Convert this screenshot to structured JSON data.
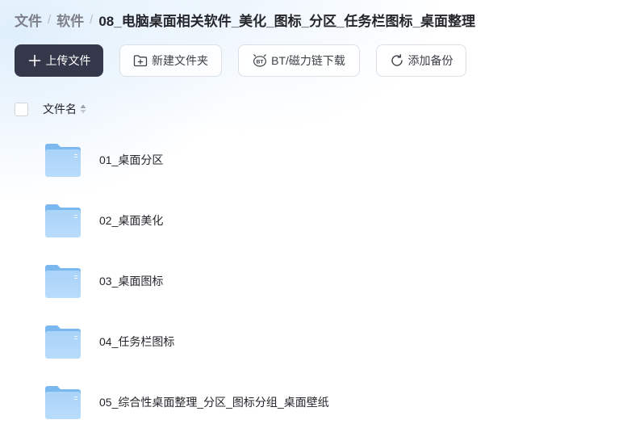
{
  "breadcrumb": {
    "items": [
      "文件",
      "软件"
    ],
    "separator": "/",
    "current": "08_电脑桌面相关软件_美化_图标_分区_任务栏图标_桌面整理"
  },
  "toolbar": {
    "upload_label": "上传文件",
    "new_folder_label": "新建文件夹",
    "bt_label": "BT/磁力链下载",
    "backup_label": "添加备份"
  },
  "list": {
    "header_label": "文件名",
    "files": [
      {
        "name": "01_桌面分区",
        "icon": "folder-icon"
      },
      {
        "name": "02_桌面美化",
        "icon": "folder-icon"
      },
      {
        "name": "03_桌面图标",
        "icon": "folder-icon"
      },
      {
        "name": "04_任务栏图标",
        "icon": "folder-icon"
      },
      {
        "name": "05_综合性桌面整理_分区_图标分组_桌面壁纸",
        "icon": "folder-icon"
      }
    ]
  },
  "colors": {
    "primary_button": "#34384a",
    "folder_light": "#a9d3f8",
    "folder_dark": "#7ab8ef"
  }
}
